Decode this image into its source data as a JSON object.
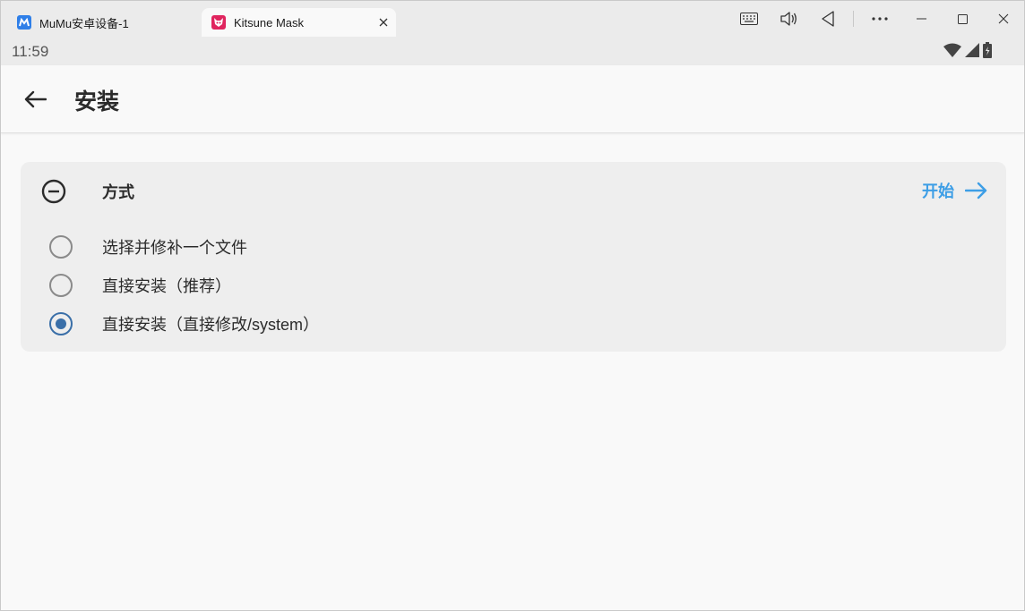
{
  "window": {
    "tabs": [
      {
        "label": "MuMu安卓设备-1",
        "icon": "mumu-icon",
        "active": false
      },
      {
        "label": "Kitsune Mask",
        "icon": "kitsune-mask-icon",
        "active": true
      }
    ],
    "controls": [
      "keyboard-icon",
      "volume-icon",
      "back-triangle-icon",
      "more-icon",
      "minimize-icon",
      "maximize-icon",
      "close-icon"
    ]
  },
  "statusbar": {
    "time": "11:59",
    "icons": [
      "wifi-icon",
      "signal-icon",
      "battery-icon"
    ]
  },
  "appbar": {
    "title": "安装",
    "back_icon": "arrow-left-icon"
  },
  "method_card": {
    "title": "方式",
    "start_label": "开始",
    "options": [
      {
        "label": "选择并修补一个文件",
        "selected": false
      },
      {
        "label": "直接安装（推荐）",
        "selected": false
      },
      {
        "label": "直接安装（直接修改/system）",
        "selected": true
      }
    ]
  },
  "colors": {
    "accent": "#3d9ee6",
    "radio_selected": "#3a6fa8",
    "card_bg": "#eeeeee"
  }
}
